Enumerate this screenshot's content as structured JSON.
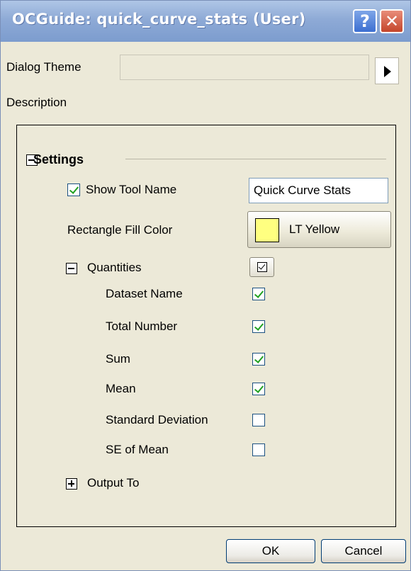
{
  "window": {
    "title": "OCGuide: quick_curve_stats (User)"
  },
  "titlebar": {
    "help_label": "?",
    "close_label": "✕"
  },
  "header": {
    "dialog_theme_label": "Dialog Theme",
    "description_label": "Description"
  },
  "settings": {
    "title": "Settings",
    "show_tool_name": {
      "label": "Show Tool Name",
      "checked": true,
      "value": "Quick Curve Stats"
    },
    "rectangle_fill_color": {
      "label": "Rectangle Fill Color",
      "value": "LT Yellow",
      "swatch": "#FFFF80"
    },
    "quantities": {
      "label": "Quantities",
      "items": [
        {
          "label": "Dataset Name",
          "checked": true
        },
        {
          "label": "Total Number",
          "checked": true
        },
        {
          "label": "Sum",
          "checked": true
        },
        {
          "label": "Mean",
          "checked": true
        },
        {
          "label": "Standard Deviation",
          "checked": false
        },
        {
          "label": "SE of Mean",
          "checked": false
        }
      ]
    },
    "output_to": {
      "label": "Output To"
    }
  },
  "buttons": {
    "ok": "OK",
    "cancel": "Cancel"
  }
}
